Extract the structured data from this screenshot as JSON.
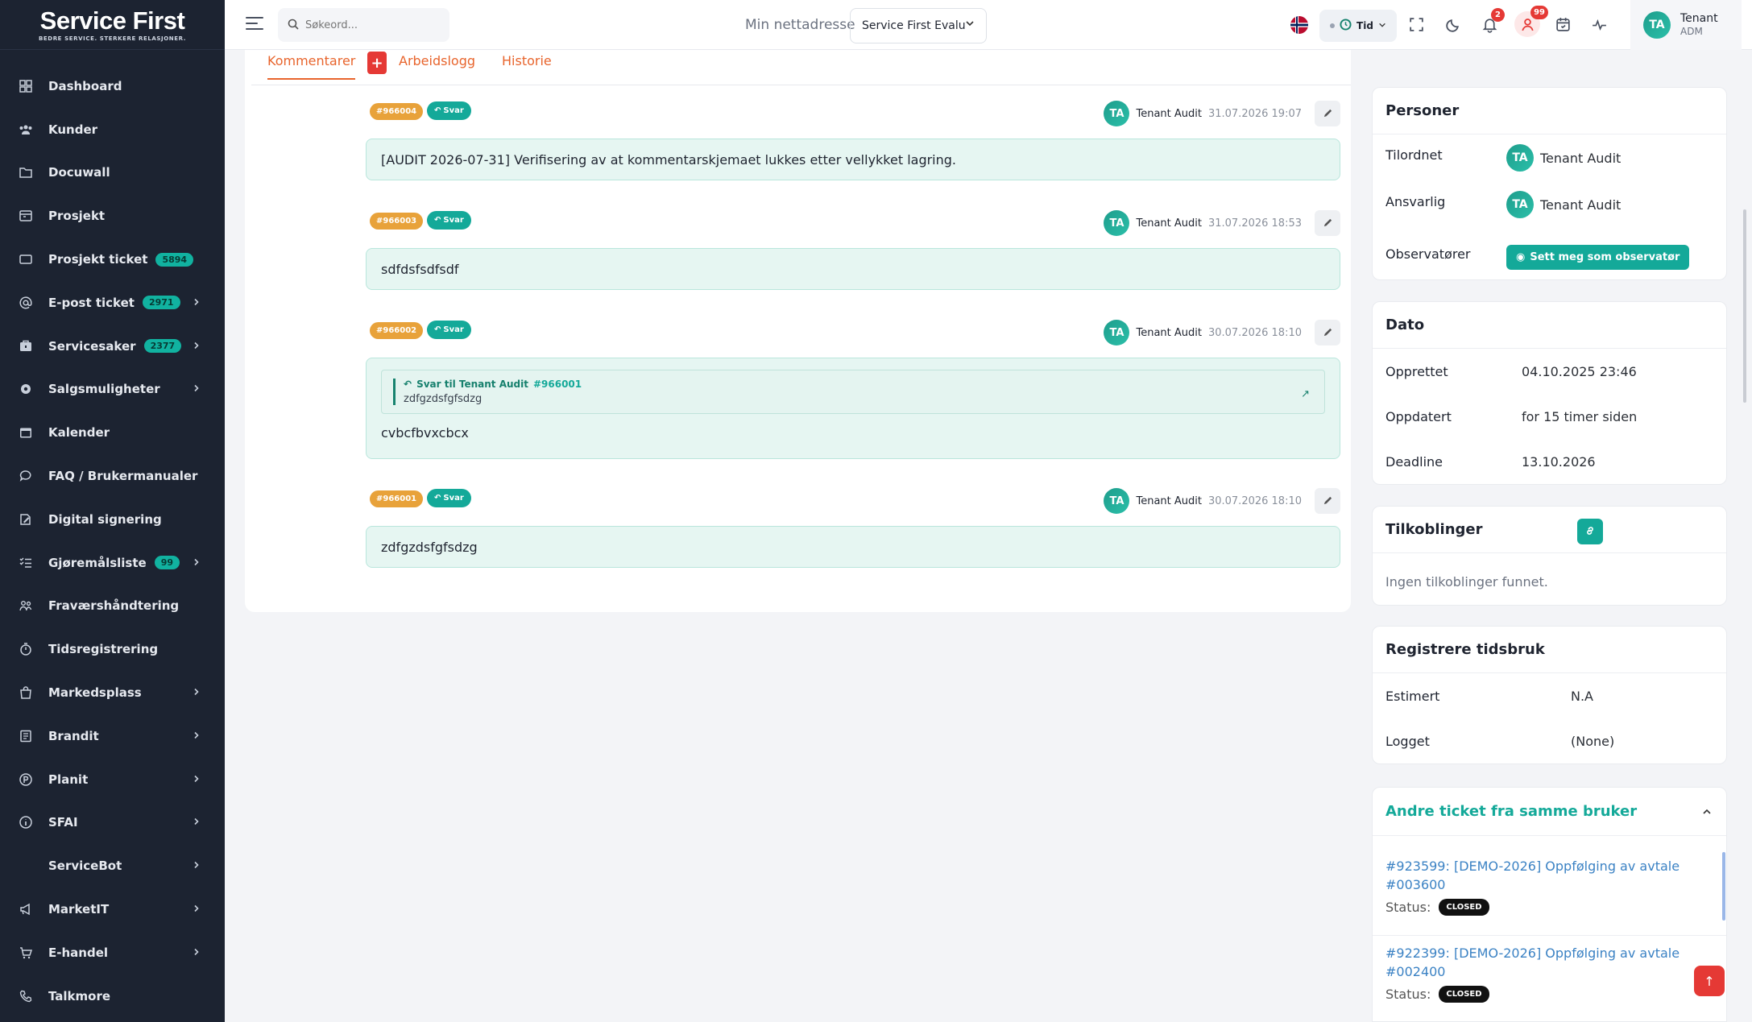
{
  "brand": {
    "name_a": "Service",
    "name_b": "First",
    "tagline": "BEDRE SERVICE. STERKERE RELASJONER."
  },
  "sidebar": {
    "items": [
      {
        "label": "Dashboard",
        "icon": "dashboard-icon"
      },
      {
        "label": "Kunder",
        "icon": "users-icon"
      },
      {
        "label": "Docuwall",
        "icon": "folder-icon"
      },
      {
        "label": "Prosjekt",
        "icon": "project-icon"
      },
      {
        "label": "Prosjekt ticket",
        "icon": "ticket-icon",
        "badge": "5894"
      },
      {
        "label": "E-post ticket",
        "icon": "at-icon",
        "badge": "2971",
        "chevron": true
      },
      {
        "label": "Servicesaker",
        "icon": "service-icon",
        "badge": "2377",
        "chevron": true
      },
      {
        "label": "Salgsmuligheter",
        "icon": "gear-icon",
        "chevron": true
      },
      {
        "label": "Kalender",
        "icon": "calendar-icon"
      },
      {
        "label": "FAQ / Brukermanualer",
        "icon": "chat-icon"
      },
      {
        "label": "Digital signering",
        "icon": "signature-icon"
      },
      {
        "label": "Gjøremålsliste",
        "icon": "checklist-icon",
        "badge": "99",
        "chevron": true
      },
      {
        "label": "Fraværshåndtering",
        "icon": "team-icon"
      },
      {
        "label": "Tidsregistrering",
        "icon": "stopwatch-icon"
      },
      {
        "label": "Markedsplass",
        "icon": "bag-icon",
        "chevron": true
      },
      {
        "label": "Brandit",
        "icon": "book-icon",
        "chevron": true
      },
      {
        "label": "Planit",
        "icon": "p-circle-icon",
        "chevron": true
      },
      {
        "label": "SFAI",
        "icon": "info-icon",
        "chevron": true
      },
      {
        "label": "ServiceBot",
        "icon": "",
        "chevron": true
      },
      {
        "label": "MarketIT",
        "icon": "megaphone-icon",
        "chevron": true
      },
      {
        "label": "E-handel",
        "icon": "cart-icon",
        "chevron": true
      },
      {
        "label": "Talkmore",
        "icon": "phone-icon"
      }
    ]
  },
  "topbar": {
    "search_placeholder": "Søkeord...",
    "address_label": "Min nettadresse",
    "address_value": "Service First Evalu",
    "tid_label": "Tid",
    "notif_count": "2",
    "people_count": "99",
    "user_initials": "TA",
    "user_name": "Tenant",
    "user_role": "ADM"
  },
  "tabs": {
    "comments": "Kommentarer",
    "plus": "+",
    "worklog": "Arbeidslogg",
    "history": "Historie"
  },
  "comments": [
    {
      "id": "#966004",
      "reply": "Svar",
      "author": "Tenant Audit",
      "initials": "TA",
      "time": "31.07.2026 19:07",
      "text": "[AUDIT 2026-07-31] Verifisering av at kommentarskjemaet lukkes etter vellykket lagring."
    },
    {
      "id": "#966003",
      "reply": "Svar",
      "author": "Tenant Audit",
      "initials": "TA",
      "time": "31.07.2026 18:53",
      "text": "sdfdsfsdfsdf"
    },
    {
      "id": "#966002",
      "reply": "Svar",
      "author": "Tenant Audit",
      "initials": "TA",
      "time": "30.07.2026 18:10",
      "text": "cvbcfbvxcbcx",
      "quote": {
        "head": "Svar til Tenant Audit",
        "ref": "#966001",
        "text": "zdfgzdsfgfsdzg"
      }
    },
    {
      "id": "#966001",
      "reply": "Svar",
      "author": "Tenant Audit",
      "initials": "TA",
      "time": "30.07.2026 18:10",
      "text": "zdfgzdsfgfsdzg"
    }
  ],
  "persons": {
    "title": "Personer",
    "assigned_label": "Tilordnet",
    "assigned_initials": "TA",
    "assigned_name": "Tenant Audit",
    "responsible_label": "Ansvarlig",
    "responsible_initials": "TA",
    "responsible_name": "Tenant Audit",
    "observers_label": "Observatører",
    "observer_button": "Sett meg som observatør"
  },
  "dates": {
    "title": "Dato",
    "created_label": "Opprettet",
    "created": "04.10.2025 23:46",
    "updated_label": "Oppdatert",
    "updated": "for 15 timer siden",
    "deadline_label": "Deadline",
    "deadline": "13.10.2026"
  },
  "connections": {
    "title": "Tilkoblinger",
    "empty": "Ingen tilkoblinger funnet."
  },
  "time_tracking": {
    "title": "Registrere tidsbruk",
    "estimated_label": "Estimert",
    "estimated": "N.A",
    "logged_label": "Logget",
    "logged": "(None)"
  },
  "other_tickets": {
    "title": "Andre ticket fra samme bruker",
    "status_label": "Status:",
    "items": [
      {
        "line1": "#923599: [DEMO-2026] Oppfølging av avtale",
        "line2": "#003600",
        "status": "CLOSED"
      },
      {
        "line1": "#922399: [DEMO-2026] Oppfølging av avtale",
        "line2": "#002400",
        "status": "CLOSED"
      }
    ]
  },
  "colors": {
    "accent": "#14a999",
    "orange": "#e8642c",
    "sidebar": "#1c2331",
    "danger": "#e53935"
  }
}
